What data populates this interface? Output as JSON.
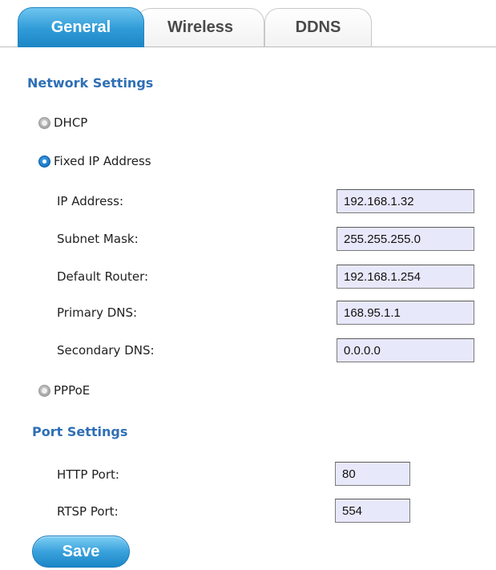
{
  "tabs": [
    {
      "label": "General",
      "active": true
    },
    {
      "label": "Wireless",
      "active": false
    },
    {
      "label": "DDNS",
      "active": false
    }
  ],
  "network": {
    "title": "Network Settings",
    "options": [
      {
        "label": "DHCP",
        "selected": false
      },
      {
        "label": "Fixed IP Address",
        "selected": true
      },
      {
        "label": "PPPoE",
        "selected": false
      }
    ],
    "fields": [
      {
        "label": "IP Address:",
        "value": "192.168.1.32"
      },
      {
        "label": "Subnet Mask:",
        "value": "255.255.255.0"
      },
      {
        "label": "Default Router:",
        "value": "192.168.1.254"
      },
      {
        "label": "Primary DNS:",
        "value": "168.95.1.1"
      },
      {
        "label": "Secondary DNS:",
        "value": "0.0.0.0"
      }
    ]
  },
  "ports": {
    "title": "Port Settings",
    "fields": [
      {
        "label": "HTTP Port:",
        "value": "80"
      },
      {
        "label": "RTSP Port:",
        "value": "554"
      }
    ]
  },
  "save_label": "Save",
  "colors": {
    "accent": "#1d86c6",
    "section_title": "#2f6fb5",
    "input_bg": "#e8e8fb"
  },
  "icons": {
    "radio_unselected": "radio-unselected-icon",
    "radio_selected": "radio-selected-icon"
  }
}
